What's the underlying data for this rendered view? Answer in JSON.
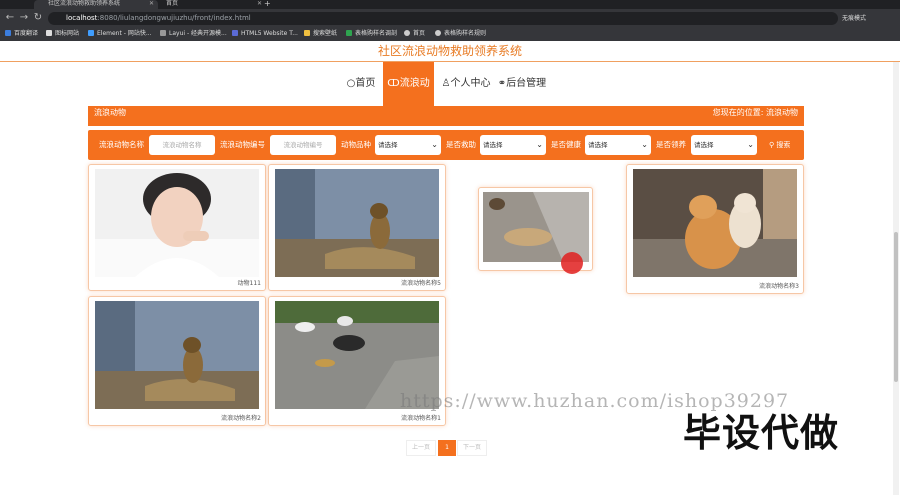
{
  "browser": {
    "tabs": [
      {
        "title": "社区流浪动物救助领养系统",
        "active": true
      },
      {
        "title": "首页",
        "active": false
      }
    ],
    "new_tab": "+",
    "url_host": "localhost",
    "url_path": ":8080/liulangdongwujiuzhu/front/index.html",
    "profile": "无痕模式",
    "bookmarks": [
      "百度翻译",
      "图标网站",
      "Element - 网站快...",
      "Layui - 经典开源模...",
      "HTML5 Website T...",
      "搜索壁纸",
      "表格购样名调剖",
      "首页",
      "表格购样名规则"
    ]
  },
  "site": {
    "title": "社区流浪动物救助领养系统",
    "nav": [
      {
        "label": "首页",
        "icon": "circle-icon"
      },
      {
        "label": "流浪动物",
        "icon": "link-icon",
        "active": true
      },
      {
        "label": "个人中心",
        "icon": "user-icon"
      },
      {
        "label": "后台管理",
        "icon": "chain-icon"
      }
    ]
  },
  "breadcrumb": {
    "section": "流浪动物",
    "location_label": "您现在的位置:",
    "location_value": "流浪动物"
  },
  "filters": {
    "name_label": "流浪动物名称",
    "name_placeholder": "流浪动物名称",
    "code_label": "流浪动物编号",
    "code_placeholder": "流浪动物编号",
    "breed_label": "动物品种",
    "rescue_label": "是否救助",
    "health_label": "是否健康",
    "adopt_label": "是否领养",
    "select_default": "请选择",
    "search_label": "搜索"
  },
  "cards": [
    {
      "caption": "动物111"
    },
    {
      "caption": "流浪动物名称5"
    },
    {
      "caption": ""
    },
    {
      "caption": "流浪动物名称3"
    },
    {
      "caption": "流浪动物名称2"
    },
    {
      "caption": "流浪动物名称1"
    }
  ],
  "pagination": {
    "prev": "上一页",
    "current": "1",
    "next": "下一页"
  },
  "overlay": {
    "watermark": "https://www.huzhan.com/ishop39297",
    "stamp": "毕设代做"
  },
  "colors": {
    "accent": "#f4701e",
    "title": "#e87b24"
  }
}
